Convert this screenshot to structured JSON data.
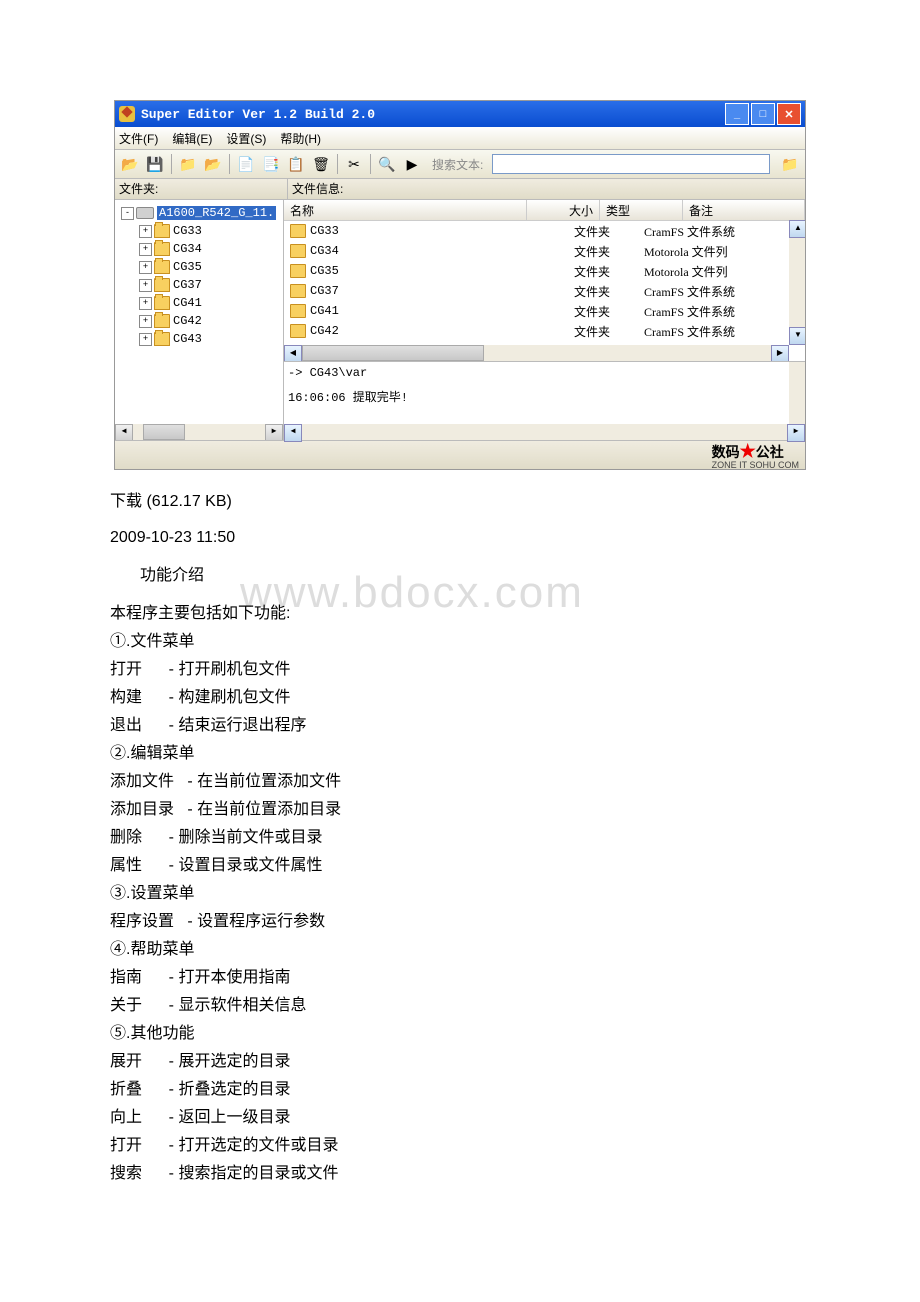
{
  "window": {
    "title": "Super Editor Ver 1.2 Build 2.0"
  },
  "menu": {
    "file": "文件(F)",
    "edit": "编辑(E)",
    "settings": "设置(S)",
    "help": "帮助(H)"
  },
  "toolbar": {
    "search_label": "搜索文本:"
  },
  "panels": {
    "folder_label": "文件夹:",
    "fileinfo_label": "文件信息:"
  },
  "tree": {
    "root": "A1600_R542_G_11.",
    "children": [
      "CG33",
      "CG34",
      "CG35",
      "CG37",
      "CG41",
      "CG42",
      "CG43"
    ]
  },
  "list": {
    "headers": {
      "name": "名称",
      "size": "大小",
      "type": "类型",
      "note": "备注"
    },
    "rows": [
      {
        "name": "CG33",
        "type": "文件夹",
        "note": "CramFS 文件系统"
      },
      {
        "name": "CG34",
        "type": "文件夹",
        "note": "Motorola 文件列"
      },
      {
        "name": "CG35",
        "type": "文件夹",
        "note": "Motorola 文件列"
      },
      {
        "name": "CG37",
        "type": "文件夹",
        "note": "CramFS 文件系统"
      },
      {
        "name": "CG41",
        "type": "文件夹",
        "note": "CramFS 文件系统"
      },
      {
        "name": "CG42",
        "type": "文件夹",
        "note": "CramFS 文件系统"
      }
    ]
  },
  "log": {
    "line1": "-> CG43\\var",
    "line2": "16:06:06 提取完毕!"
  },
  "branding": {
    "text1a": "数码",
    "text1b": "公社",
    "text2": "ZONE IT SOHU COM"
  },
  "caption": {
    "download": "下载 (612.17 KB)",
    "date": "2009-10-23 11:50"
  },
  "watermark": "www.bdocx.com",
  "doc": {
    "section_title": "功能介绍",
    "intro": "本程序主要包括如下功能:",
    "s1": "①.文件菜单",
    "s1_1": "打开      - 打开刷机包文件",
    "s1_2": "构建      - 构建刷机包文件",
    "s1_3": "退出      - 结束运行退出程序",
    "s2": "②.编辑菜单",
    "s2_1": "添加文件   - 在当前位置添加文件",
    "s2_2": "添加目录   - 在当前位置添加目录",
    "s2_3": "删除      - 删除当前文件或目录",
    "s2_4": "属性      - 设置目录或文件属性",
    "s3": "③.设置菜单",
    "s3_1": "程序设置   - 设置程序运行参数",
    "s4": "④.帮助菜单",
    "s4_1": "指南      - 打开本使用指南",
    "s4_2": "关于      - 显示软件相关信息",
    "s5": "⑤.其他功能",
    "s5_1": "展开      - 展开选定的目录",
    "s5_2": "折叠      - 折叠选定的目录",
    "s5_3": "向上      - 返回上一级目录",
    "s5_4": "打开      - 打开选定的文件或目录",
    "s5_5": "搜索      - 搜索指定的目录或文件"
  }
}
